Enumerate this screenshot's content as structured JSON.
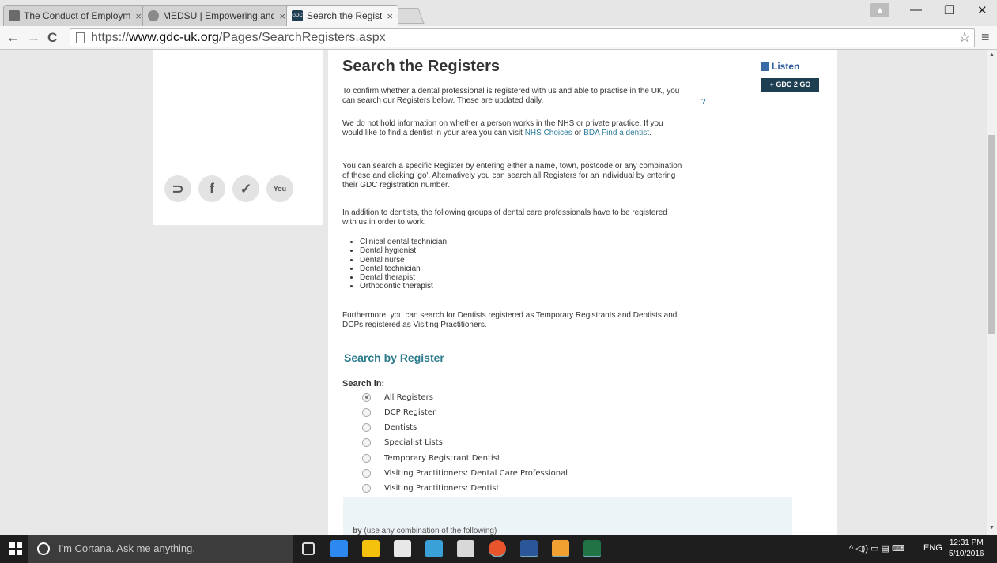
{
  "browser": {
    "tabs": [
      {
        "title": "The Conduct of Employme",
        "favicon_color": "#6b6b6b"
      },
      {
        "title": "MEDSU | Empowering and",
        "favicon_color": "#8a8a8a"
      },
      {
        "title": "Search the Registers",
        "favicon_color": "#1e3e52",
        "favicon_text": "GDC"
      }
    ],
    "close_glyph": "×",
    "window_controls": {
      "minimize": "—",
      "restore": "❐",
      "close": "✕"
    },
    "url_scheme": "https://",
    "url_host": "www.gdc-uk.org",
    "url_path": "/Pages/SearchRegisters.aspx"
  },
  "page": {
    "title": "Search the Registers",
    "listen_label": "Listen",
    "gdc2go_label": "+ GDC 2 GO",
    "intro": "To confirm whether a dental professional is registered with us and able to practise in the UK, you can search our Registers below. These are updated daily.",
    "help_marker": "?",
    "nhs_para_prefix": "We do not hold information on whether a person works in the NHS or private practice. If you would like to find a dentist in your area you can visit ",
    "nhs_link": "NHS Choices",
    "nhs_or": " or ",
    "bda_link": "BDA Find a dentist",
    "nhs_suffix": ".",
    "search_para": "You can search a specific Register by entering either a name, town, postcode or any combination of these and clicking 'go'. Alternatively you can search all Registers for an individual by entering their GDC registration number.",
    "groups_para": "In addition to dentists, the following groups of dental care professionals have to be registered with us in order to work:",
    "groups": [
      "Clinical dental technician",
      "Dental hygienist",
      "Dental nurse",
      "Dental technician",
      "Dental therapist",
      "Orthodontic therapist"
    ],
    "further_para": "Furthermore, you can search for Dentists registered as Temporary Registrants and Dentists and DCPs registered as Visiting Practitioners.",
    "search_by_heading": "Search by Register",
    "search_in_label": "Search in:",
    "registers": [
      {
        "label": "All Registers",
        "selected": true
      },
      {
        "label": "DCP Register",
        "selected": false
      },
      {
        "label": "Dentists",
        "selected": false
      },
      {
        "label": "Specialist Lists",
        "selected": false
      },
      {
        "label": "Temporary Registrant Dentist",
        "selected": false
      },
      {
        "label": "Visiting Practitioners: Dental Care Professional",
        "selected": false
      },
      {
        "label": "Visiting Practitioners: Dentist",
        "selected": false
      }
    ],
    "by_label": "by",
    "by_hint": "(use any combination of the following)",
    "social": {
      "rss": "⊃",
      "facebook": "f",
      "twitter": "✓",
      "youtube": "You"
    }
  },
  "taskbar": {
    "cortana_placeholder": "I'm Cortana. Ask me anything.",
    "language": "ENG",
    "time": "12:31 PM",
    "date": "5/10/2016",
    "tray_icons": "^ ◁)) ▭ ▤ ⌨",
    "app_colors": [
      "#2d89ef",
      "#f4c20d",
      "#e8e8e8",
      "#3aa0d8",
      "#d8d8d8",
      "#e8542c",
      "#2b579a",
      "#f0a030",
      "#217346"
    ]
  }
}
